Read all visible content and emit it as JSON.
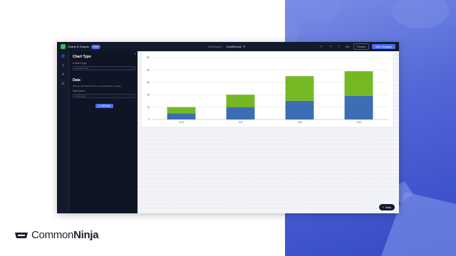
{
  "topbar": {
    "app_name": "Charts & Graphs",
    "plan_badge": "Free",
    "breadcrumb_parent": "Dashboard",
    "breadcrumb_separator": "/",
    "breadcrumb_current": "ChartDemo2",
    "undo_label": "↶",
    "redo_label": "↷",
    "share_label": "⇪",
    "code_label": "</>",
    "preview_label": "Preview",
    "save_label": "Save Changes"
  },
  "iconbar": {
    "items": [
      "chart-icon",
      "palette-icon",
      "gear-icon",
      "list-icon"
    ]
  },
  "panel": {
    "close_label": "×",
    "chart_type_heading": "Chart Type",
    "select_type_label": "Select Type",
    "select_type_value": "Stacked Chart",
    "data_heading": "Data",
    "data_description": "Click the 'Edit Data' button to import/add/edit your data",
    "data_source_label": "Data Source",
    "data_source_value": "Static Data",
    "edit_data_label": "Edit Data"
  },
  "help": {
    "label": "Help"
  },
  "brand": {
    "name_light": "Common",
    "name_bold": "Ninja"
  },
  "colors": {
    "series_a": "#3d6db5",
    "series_b": "#74b824",
    "accent": "#4a6cf7"
  },
  "chart_data": {
    "type": "bar",
    "stacked": true,
    "categories": [
      "1/12",
      "1/22",
      "1/32",
      "1/42"
    ],
    "series": [
      {
        "name": "",
        "values": [
          5,
          10,
          15,
          19
        ],
        "color": "#3d6db5"
      },
      {
        "name": "",
        "values": [
          5,
          10,
          20,
          20
        ],
        "color": "#74b824"
      }
    ],
    "ylim": [
      0,
      50
    ],
    "yticks": [
      0,
      10,
      20,
      30,
      40,
      50
    ],
    "grid": true
  }
}
